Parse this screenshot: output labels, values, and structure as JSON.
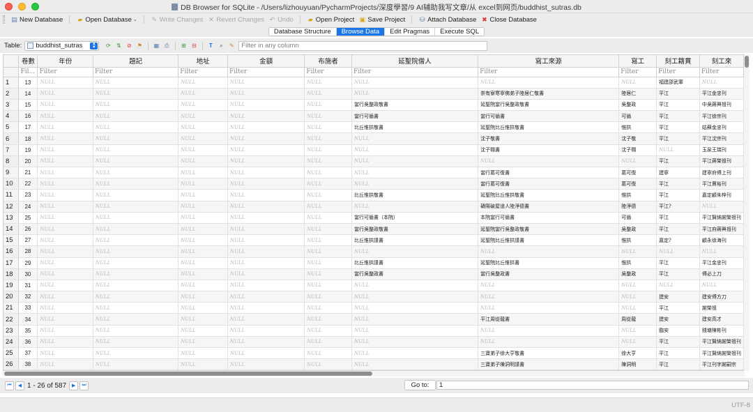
{
  "window": {
    "title": "DB Browser for SQLite - /Users/lizhouyuan/PycharmProjects/深度學習/9 AI辅助我写文章/从 excel到网页/buddhist_sutras.db"
  },
  "toolbar": {
    "new_database": "New Database",
    "open_database": "Open Database",
    "write_changes": "Write Changes",
    "revert_changes": "Revert Changes",
    "undo": "Undo",
    "open_project": "Open Project",
    "save_project": "Save Project",
    "attach_database": "Attach Database",
    "close_database": "Close Database"
  },
  "tabs": [
    "Database Structure",
    "Browse Data",
    "Edit Pragmas",
    "Execute SQL"
  ],
  "active_tab": "Browse Data",
  "filterbar": {
    "table_label": "Table:",
    "table_value": "buddhist_sutras",
    "filter_placeholder": "Filter in any column"
  },
  "grid": {
    "columns": [
      "卷數",
      "年份",
      "題記",
      "地址",
      "金額",
      "布施者",
      "延聖院僧人",
      "寫工來源",
      "寫工",
      "刻工籍貫",
      "刻工來"
    ],
    "filter_placeholder": "Filter",
    "filter_short": "Fil...",
    "null_text": "NULL",
    "rows": [
      {
        "n": "1",
        "c": [
          "13",
          "NULL",
          "NULL",
          "NULL",
          "NULL",
          "NULL",
          "NULL",
          "NULL",
          "NULL",
          "福建邵武軍",
          "NULL"
        ]
      },
      {
        "n": "2",
        "c": [
          "14",
          "NULL",
          "NULL",
          "NULL",
          "NULL",
          "NULL",
          "NULL",
          "崇有寮寒寧佛弟子陸居仁敬書",
          "陸居仁",
          "平江",
          "平江金忠刊"
        ]
      },
      {
        "n": "3",
        "c": [
          "15",
          "NULL",
          "NULL",
          "NULL",
          "NULL",
          "NULL",
          "當行吳整政敬書",
          "延聖院當行吳整政敬書",
          "吳整政",
          "平江",
          "中吳蔣興祖刊"
        ]
      },
      {
        "n": "4",
        "c": [
          "16",
          "NULL",
          "NULL",
          "NULL",
          "NULL",
          "NULL",
          "當行可循書",
          "當行可循書",
          "可循",
          "平江",
          "平江徐宗刊"
        ]
      },
      {
        "n": "5",
        "c": [
          "17",
          "NULL",
          "NULL",
          "NULL",
          "NULL",
          "NULL",
          "比丘惟拱敬書",
          "延聖院比丘惟拱敬書",
          "惟拱",
          "平江",
          "姑蘇金忠刊"
        ]
      },
      {
        "n": "6",
        "c": [
          "18",
          "NULL",
          "NULL",
          "NULL",
          "NULL",
          "NULL",
          "NULL",
          "沈子敬書",
          "沈子敬",
          "平江",
          "平江沈宗刊"
        ]
      },
      {
        "n": "7",
        "c": [
          "19",
          "NULL",
          "NULL",
          "NULL",
          "NULL",
          "NULL",
          "NULL",
          "沈子翱書",
          "沈子翱",
          "NULL",
          "玉泉王瑞刊"
        ]
      },
      {
        "n": "8",
        "c": [
          "20",
          "NULL",
          "NULL",
          "NULL",
          "NULL",
          "NULL",
          "NULL",
          "NULL",
          "NULL",
          "平江",
          "平江蔣榮祖刊"
        ]
      },
      {
        "n": "9",
        "c": [
          "21",
          "NULL",
          "NULL",
          "NULL",
          "NULL",
          "NULL",
          "NULL",
          "當行葛可復書",
          "葛可復",
          "建寧",
          "建寧府傅上刊"
        ]
      },
      {
        "n": "10",
        "c": [
          "22",
          "NULL",
          "NULL",
          "NULL",
          "NULL",
          "NULL",
          "NULL",
          "當行葛可復書",
          "葛可復",
          "平江",
          "平江賈裕刊"
        ]
      },
      {
        "n": "11",
        "c": [
          "23",
          "NULL",
          "NULL",
          "NULL",
          "NULL",
          "NULL",
          "比丘惟拱敬書",
          "延聖院比丘惟拱敬書",
          "惟拱",
          "平江",
          "嘉定顧朱梓刊"
        ]
      },
      {
        "n": "12",
        "c": [
          "24",
          "NULL",
          "NULL",
          "NULL",
          "NULL",
          "NULL",
          "NULL",
          "磧陽破屋道人陸淨德書",
          "陸淨德",
          "平江?",
          "NULL"
        ]
      },
      {
        "n": "13",
        "c": [
          "25",
          "NULL",
          "NULL",
          "NULL",
          "NULL",
          "NULL",
          "當行可循書（本院）",
          "本院當行可循書",
          "可循",
          "平江",
          "平江賢納謝榮祖刊"
        ]
      },
      {
        "n": "14",
        "c": [
          "26",
          "NULL",
          "NULL",
          "NULL",
          "NULL",
          "NULL",
          "當行吳整政敬書",
          "延聖院當行吳整政敬書",
          "吳整政",
          "平江",
          "平江府蔣興祖刊"
        ]
      },
      {
        "n": "15",
        "c": [
          "27",
          "NULL",
          "NULL",
          "NULL",
          "NULL",
          "NULL",
          "比丘惟拱謹書",
          "延聖院比丘惟拱謹書",
          "惟拱",
          "嘉定?",
          "顧永徐海刊"
        ]
      },
      {
        "n": "16",
        "c": [
          "28",
          "NULL",
          "NULL",
          "NULL",
          "NULL",
          "NULL",
          "NULL",
          "NULL",
          "NULL",
          "NULL",
          "NULL"
        ]
      },
      {
        "n": "17",
        "c": [
          "29",
          "NULL",
          "NULL",
          "NULL",
          "NULL",
          "NULL",
          "比丘惟拱謹書",
          "延聖院比丘惟拱書",
          "惟拱",
          "平江",
          "平江金忠刊"
        ]
      },
      {
        "n": "18",
        "c": [
          "30",
          "NULL",
          "NULL",
          "NULL",
          "NULL",
          "NULL",
          "當行吳整政書",
          "當行吳整政書",
          "吳整政",
          "平江",
          "傅必上刀"
        ]
      },
      {
        "n": "19",
        "c": [
          "31",
          "NULL",
          "NULL",
          "NULL",
          "NULL",
          "NULL",
          "NULL",
          "NULL",
          "NULL",
          "NULL",
          "NULL"
        ]
      },
      {
        "n": "20",
        "c": [
          "32",
          "NULL",
          "NULL",
          "NULL",
          "NULL",
          "NULL",
          "NULL",
          "NULL",
          "NULL",
          "建安",
          "建安傅方刀"
        ]
      },
      {
        "n": "21",
        "c": [
          "33",
          "NULL",
          "NULL",
          "NULL",
          "NULL",
          "NULL",
          "NULL",
          "NULL",
          "NULL",
          "平江",
          "謝榮祖"
        ]
      },
      {
        "n": "22",
        "c": [
          "34",
          "NULL",
          "NULL",
          "NULL",
          "NULL",
          "NULL",
          "NULL",
          "平江周從龍書",
          "周從龍",
          "建安",
          "建安高才"
        ]
      },
      {
        "n": "23",
        "c": [
          "35",
          "NULL",
          "NULL",
          "NULL",
          "NULL",
          "NULL",
          "NULL",
          "NULL",
          "NULL",
          "臨安",
          "錢塘陳彬刊"
        ]
      },
      {
        "n": "24",
        "c": [
          "36",
          "NULL",
          "NULL",
          "NULL",
          "NULL",
          "NULL",
          "NULL",
          "NULL",
          "NULL",
          "平江",
          "平江賢納謝榮祖刊"
        ]
      },
      {
        "n": "25",
        "c": [
          "37",
          "NULL",
          "NULL",
          "NULL",
          "NULL",
          "NULL",
          "NULL",
          "三寶弟子徐大亨敬書",
          "徐大亨",
          "平江",
          "平江賢納謝榮祖刊"
        ]
      },
      {
        "n": "26",
        "c": [
          "38",
          "NULL",
          "NULL",
          "NULL",
          "NULL",
          "NULL",
          "NULL",
          "三寶弟子陳洞明謹書",
          "陳洞明",
          "平江",
          "平江刊字謝嗣宗"
        ]
      }
    ]
  },
  "navigation": {
    "page_info": "1 - 26 of 587",
    "goto_label": "Go to:",
    "goto_value": "1"
  },
  "status": {
    "encoding": "UTF-8"
  },
  "colors": {
    "accent": "#1a75e8",
    "chrome": "#ececec"
  }
}
